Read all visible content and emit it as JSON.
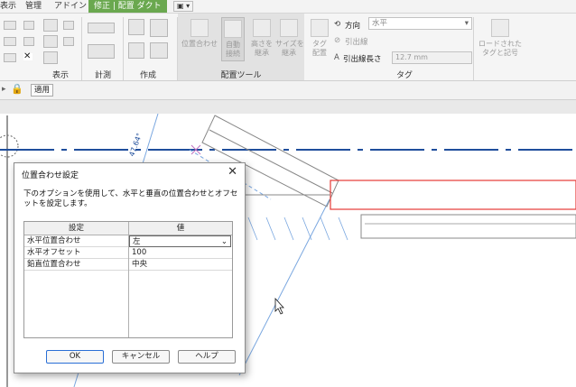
{
  "tabs": {
    "view": "表示",
    "manage": "管理",
    "addin": "アドイン",
    "context": "修正 | 配置 ダクト",
    "dropdown": "▣ ▾"
  },
  "ribbon": {
    "panels": {
      "view": "表示",
      "measure": "計測",
      "create": "作成",
      "place_tools": "配置ツール",
      "tag": "タグ"
    },
    "place_tools": {
      "align": "位置合わせ",
      "auto_connect": "自動\n接続",
      "inherit_height": "高さを\n継承",
      "inherit_size": "サイズを\n継承"
    },
    "tag": {
      "tag_on_place": "タグ\n配置",
      "orientation_label": "方向",
      "orientation_value": "水平",
      "leader_label": "引出線",
      "leader_length_label": "引出線長さ",
      "leader_length_value": "12.7 mm",
      "loaded_tags": "ロードされた\nタグと記号"
    }
  },
  "optionsbar": {
    "apply": "適用"
  },
  "drawing": {
    "angle_label": "47.64°"
  },
  "dialog": {
    "title": "位置合わせ設定",
    "close": "✕",
    "description": "下のオプションを使用して、水平と垂直の位置合わせとオフセットを設定します。",
    "columns": [
      "設定",
      "値"
    ],
    "rows": [
      {
        "setting": "水平位置合わせ",
        "value": "左"
      },
      {
        "setting": "水平オフセット",
        "value": "100"
      },
      {
        "setting": "鉛直位置合わせ",
        "value": "中央"
      }
    ],
    "ok": "OK",
    "cancel": "キャンセル",
    "help": "ヘルプ"
  },
  "colors": {
    "accent": "#6aa84f",
    "duct_line": "#1f4e9c",
    "selection": "#e53935",
    "reference": "#7aa7e0"
  }
}
